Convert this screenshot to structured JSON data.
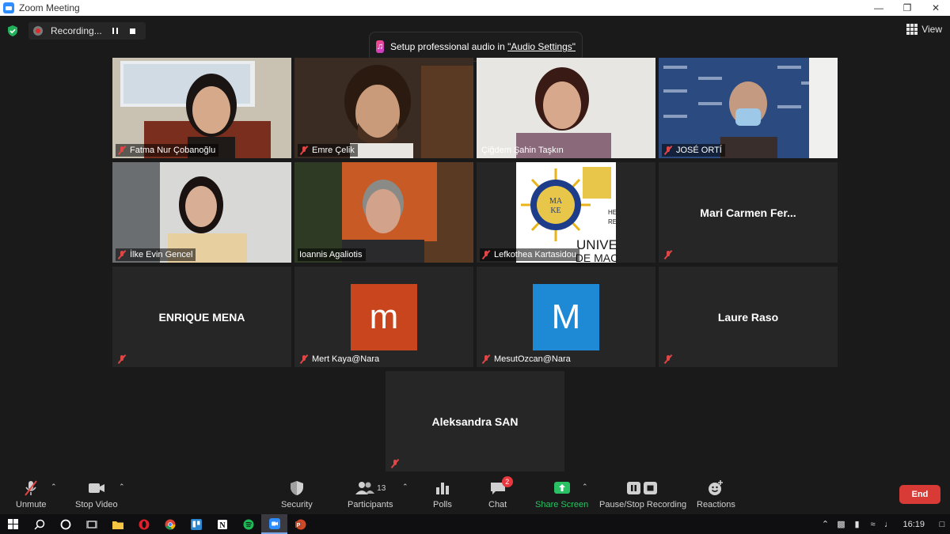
{
  "window": {
    "title": "Zoom Meeting",
    "minimize_icon": "minimize-icon",
    "maximize_icon": "restore-icon",
    "close_icon": "close-icon"
  },
  "topbar": {
    "security_icon": "shield-check-icon",
    "recording_label": "Recording...",
    "pause_icon": "pause-icon",
    "stop_icon": "stop-icon",
    "banner_text": "Setup professional audio in ",
    "banner_link": "\"Audio Settings\"",
    "view_label": "View"
  },
  "participants": [
    {
      "name": "Fatma Nur Çobanoğlu",
      "video": true,
      "muted": true
    },
    {
      "name": "Emre Çelik",
      "video": true,
      "muted": true
    },
    {
      "name": "Çiğdem Şahin Taşkın",
      "video": true,
      "muted": false
    },
    {
      "name": "JOSÉ ORTÍ",
      "video": true,
      "muted": true
    },
    {
      "name": "İlke Evin Gencel",
      "video": true,
      "muted": true
    },
    {
      "name": "Ioannis Agaliotis",
      "video": true,
      "muted": false,
      "active_speaker": true
    },
    {
      "name": "Lefkothea Kartasidou",
      "video": true,
      "muted": true
    },
    {
      "name": "Mari Carmen Fer...",
      "video": false,
      "muted": true
    },
    {
      "name": "ENRIQUE MENA",
      "video": false,
      "muted": true
    },
    {
      "name": "Mert Kaya@Nara",
      "video": false,
      "muted": true,
      "avatar_letter": "m",
      "avatar_color": "#c8451e"
    },
    {
      "name": "MesutOzcan@Nara",
      "video": false,
      "muted": true,
      "avatar_letter": "M",
      "avatar_color": "#1e8ad6"
    },
    {
      "name": "Laure Raso",
      "video": false,
      "muted": true
    },
    {
      "name": "Aleksandra SAN",
      "video": false,
      "muted": true
    }
  ],
  "logo_text": {
    "line1": "UNIVE",
    "line2": "DE MAC",
    "side": "HE\nRE",
    "seal": "MA KE"
  },
  "toolbar": {
    "unmute": "Unmute",
    "stop_video": "Stop Video",
    "security": "Security",
    "participants": "Participants",
    "participant_count": "13",
    "polls": "Polls",
    "chat": "Chat",
    "chat_badge": "2",
    "share_screen": "Share Screen",
    "pause_stop_recording": "Pause/Stop Recording",
    "reactions": "Reactions",
    "end": "End"
  },
  "taskbar": {
    "clock": "16:19",
    "items": [
      "windows-start-icon",
      "search-icon",
      "cortana-icon",
      "task-view-icon",
      "file-explorer-icon",
      "opera-icon",
      "chrome-icon",
      "trello-icon",
      "notion-icon",
      "spotify-icon",
      "zoom-icon",
      "powerpoint-icon"
    ]
  },
  "colors": {
    "background": "#1a1a1a",
    "tile": "#262626",
    "active_speaker": "#d2e27e",
    "share_green": "#2ac164",
    "end_red": "#d83a36",
    "mute_red": "#e04646"
  }
}
